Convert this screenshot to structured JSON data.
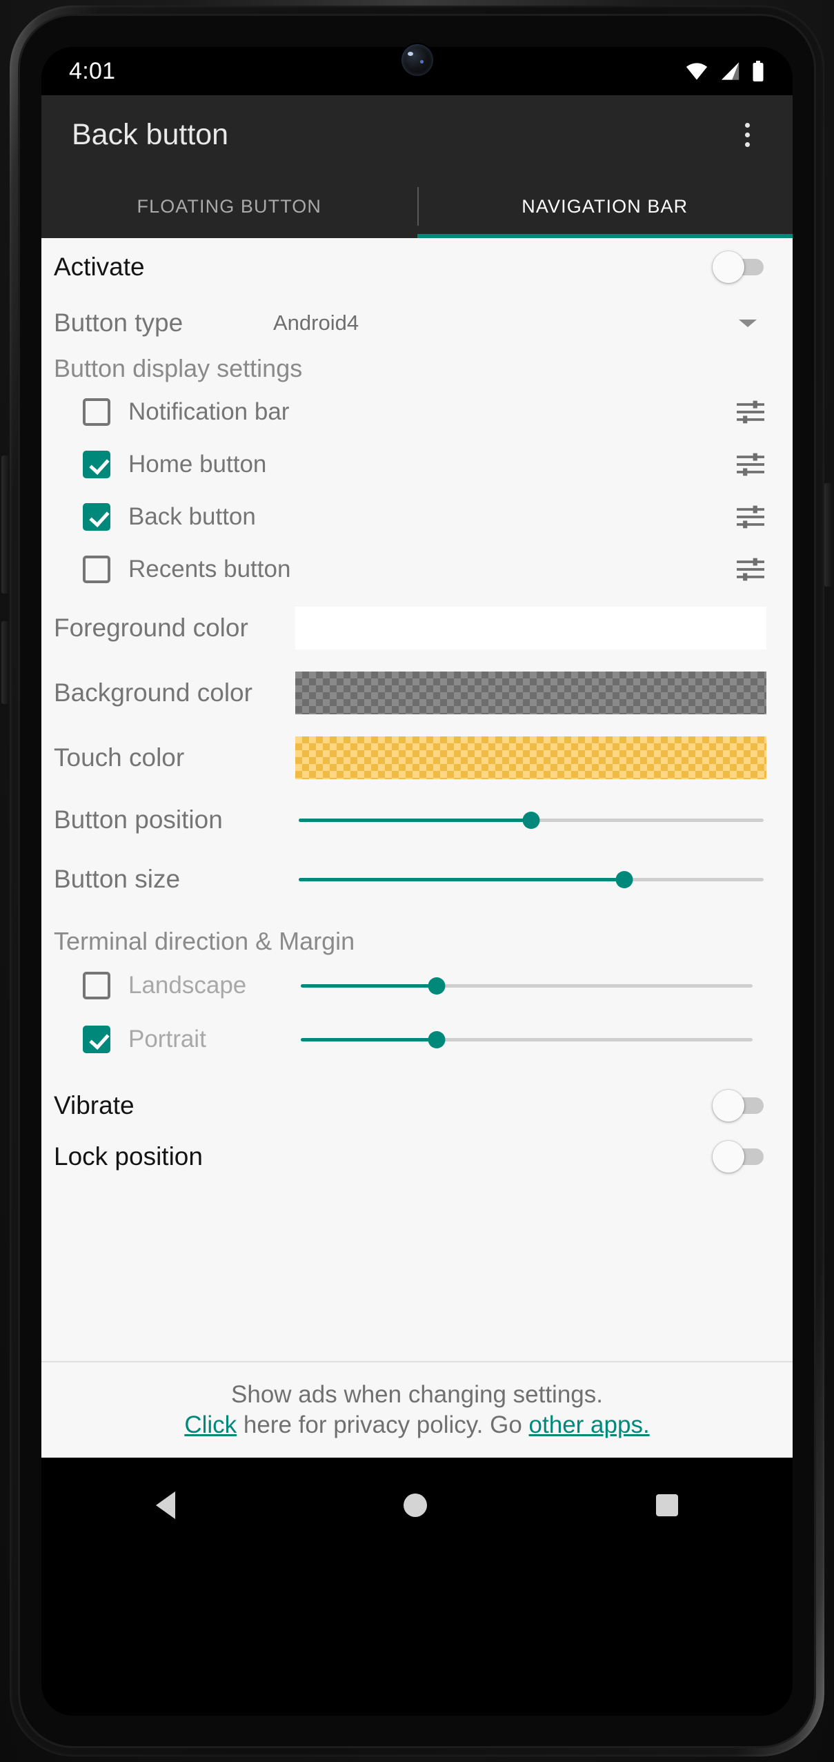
{
  "status_bar": {
    "time": "4:01",
    "icons": [
      "wifi-icon",
      "signal-icon",
      "battery-icon"
    ]
  },
  "app_bar": {
    "title": "Back button",
    "overflow_icon": "more-vert-icon"
  },
  "tabs": [
    {
      "label": "FLOATING BUTTON",
      "active": false
    },
    {
      "label": "NAVIGATION BAR",
      "active": true
    }
  ],
  "settings": {
    "activate": {
      "label": "Activate",
      "enabled": false
    },
    "button_type": {
      "label": "Button type",
      "value": "Android4"
    },
    "display_settings_header": "Button display settings",
    "display_items": [
      {
        "label": "Notification bar",
        "checked": false
      },
      {
        "label": "Home button",
        "checked": true
      },
      {
        "label": "Back button",
        "checked": true
      },
      {
        "label": "Recents button",
        "checked": false
      }
    ],
    "colors": [
      {
        "label": "Foreground color",
        "kind": "fg"
      },
      {
        "label": "Background color",
        "kind": "bg"
      },
      {
        "label": "Touch color",
        "kind": "touch"
      }
    ],
    "sliders": [
      {
        "label": "Button position",
        "percent": 50
      },
      {
        "label": "Button size",
        "percent": 70
      }
    ],
    "terminal_header": "Terminal direction & Margin",
    "margins": [
      {
        "label": "Landscape",
        "checked": false,
        "percent": 30
      },
      {
        "label": "Portrait",
        "checked": true,
        "percent": 30
      }
    ],
    "toggles": [
      {
        "label": "Vibrate",
        "enabled": false
      },
      {
        "label": "Lock position",
        "enabled": false
      }
    ]
  },
  "ad": {
    "line1": "Show ads when changing settings.",
    "link1": "Click",
    "mid": " here for privacy policy. Go ",
    "link2": "other apps."
  },
  "nav_bar": {
    "back": "back-nav-icon",
    "home": "home-nav-icon",
    "recents": "recents-nav-icon"
  },
  "theme": {
    "accent": "#00897b",
    "app_bar_bg": "#262626",
    "content_bg": "#f7f7f7"
  }
}
